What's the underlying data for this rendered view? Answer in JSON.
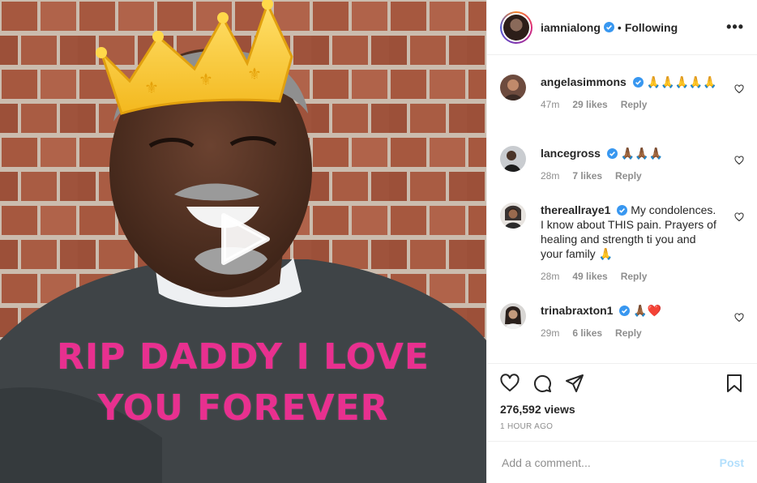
{
  "media": {
    "overlay_line1": "RIP DADDY I LOVE",
    "overlay_line2": "YOU FOREVER",
    "icons": {
      "play": "play-icon",
      "crown": "crown-icon"
    }
  },
  "header": {
    "username": "iamnialong",
    "separator": "•",
    "follow_status": "Following",
    "more_label": "•••"
  },
  "comments": [
    {
      "user": "angelasimmons",
      "text": "🙏🙏🙏🙏🙏",
      "age": "47m",
      "likes": "29 likes",
      "reply": "Reply"
    },
    {
      "user": "lancegross",
      "text": "🙏🏾🙏🏾🙏🏾",
      "age": "28m",
      "likes": "7 likes",
      "reply": "Reply"
    },
    {
      "user": "thereallraye1",
      "text": "My condolences. I know about THIS pain. Prayers of healing and strength ti you and your family 🙏",
      "age": "28m",
      "likes": "49 likes",
      "reply": "Reply"
    },
    {
      "user": "trinabraxton1",
      "text": "🙏🏾❤️",
      "age": "29m",
      "likes": "6 likes",
      "reply": "Reply"
    }
  ],
  "stats": {
    "views": "276,592 views",
    "posted": "1 HOUR AGO"
  },
  "add_comment": {
    "placeholder": "Add a comment...",
    "post_label": "Post"
  },
  "colors": {
    "verified": "#3897f0",
    "overlay_text": "#e8308f",
    "post_button": "#b2dffc",
    "muted": "#8e8e8e"
  }
}
